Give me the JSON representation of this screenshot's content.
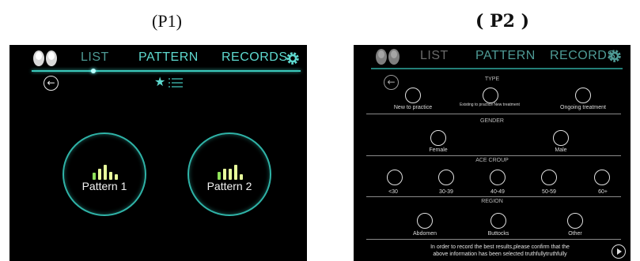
{
  "captions": {
    "left": "(P1)",
    "right": "( P2 )"
  },
  "nav": {
    "list": "LIST",
    "pattern": "PATTERN",
    "records": "RECORDS"
  },
  "icons": {
    "back": "arrow-left-icon",
    "star": "star-icon",
    "list": "list-icon",
    "settings": "gear-icon",
    "devices": "earbuds-icon",
    "next": "play-icon"
  },
  "colors": {
    "accent": "#5ed9cf",
    "bar_light": "#e8ff9c",
    "bar_green": "#8fe05a",
    "background": "#000000"
  },
  "p1": {
    "patterns": [
      "Pattern 1",
      "Pattern 2"
    ]
  },
  "p2": {
    "type": {
      "title": "TYPE",
      "options": [
        "New to practice",
        "Existing to practice New treatment",
        "Ongoing treatment"
      ]
    },
    "gender": {
      "title": "GENDER",
      "options": [
        "Female",
        "Male"
      ]
    },
    "age": {
      "title": "ACE CROUP",
      "options": [
        "<30",
        "30-39",
        "40-49",
        "50-59",
        "60+"
      ]
    },
    "region": {
      "title": "REGION",
      "options": [
        "Abdomen",
        "Buttocks",
        "Other"
      ]
    },
    "note_line1": "In order to record the best results,please confirm that the",
    "note_line2": "above information has been selected truthfullytruthfully"
  }
}
